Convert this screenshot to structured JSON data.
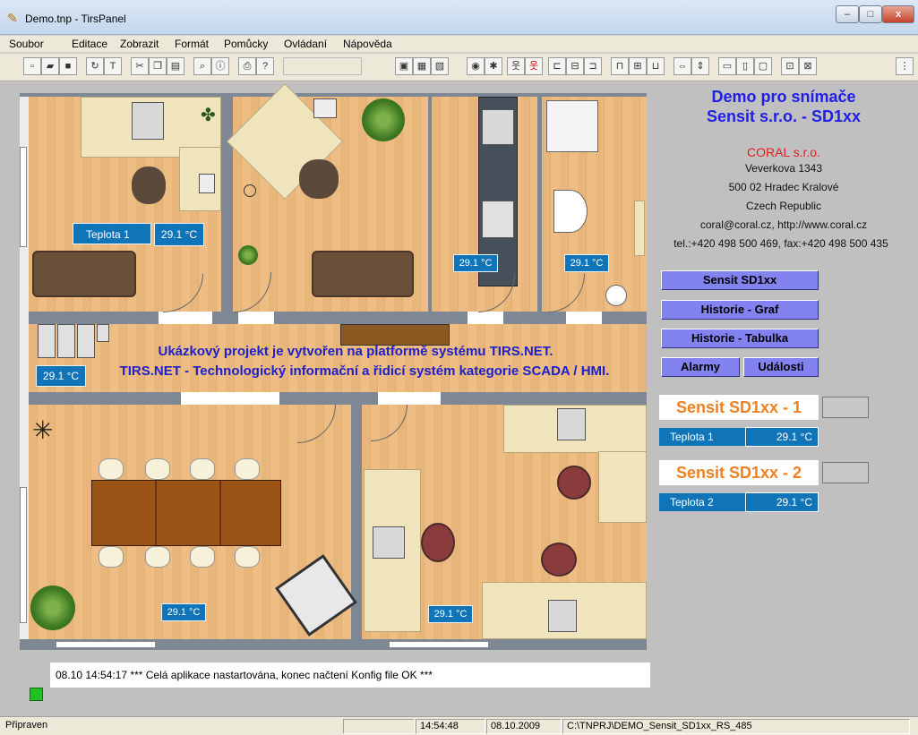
{
  "window": {
    "title": "Demo.tnp - TirsPanel",
    "min": "–",
    "max": "□",
    "close": "x"
  },
  "menu": [
    "Soubor",
    "Editace",
    "Zobrazit",
    "Formát",
    "Pomůcky",
    "Ovládaní",
    "Nápověda"
  ],
  "panel": {
    "title1": "Demo pro snímače",
    "title2": "Sensit s.r.o. - SD1xx",
    "company": "CORAL s.r.o.",
    "street": "Veverkova 1343",
    "city": "500 02  Hradec Kralové",
    "country": "Czech Republic",
    "web": "coral@coral.cz, http://www.coral.cz",
    "phone": "tel.:+420 498 500 469, fax:+420 498 500 435",
    "btn_sensit": "Sensit SD1xx",
    "btn_graph": "Historie - Graf",
    "btn_table": "Historie - Tabulka",
    "btn_alarms": "Alarmy",
    "btn_events": "Události",
    "sensor1_title": "Sensit SD1xx - 1",
    "sensor1_label": "Teplota 1",
    "sensor1_value": "29.1 °C",
    "sensor2_title": "Sensit SD1xx - 2",
    "sensor2_label": "Teplota 2",
    "sensor2_value": "29.1 °C"
  },
  "plan": {
    "room1_label": "Teplota 1",
    "room1_value": "29.1 °C",
    "kitchen_value": "29.1 °C",
    "bath_value": "29.1 °C",
    "hall_value": "29.1 °C",
    "meeting_value": "29.1 °C",
    "office_value": "29.1 °C",
    "banner1": "Ukázkový projekt je vytvořen na platformě systému TIRS.NET.",
    "banner2": "TIRS.NET - Technologický informační a řidicí systém kategorie SCADA / HMI."
  },
  "log": "08.10 14:54:17  *** Celá aplikace nastartována, konec načtení Konfig file OK ***",
  "status": {
    "state": "Připraven",
    "time": "14:54:48",
    "date": "08.10.2009",
    "path": "C:\\TNPRJ\\DEMO_Sensit_SD1xx_RS_485"
  },
  "colors": {
    "accent_blue": "#2020e8",
    "sensor_orange": "#f08020",
    "temp_bg": "#1074b8",
    "button": "#8282f0",
    "company_red": "#e02020"
  }
}
